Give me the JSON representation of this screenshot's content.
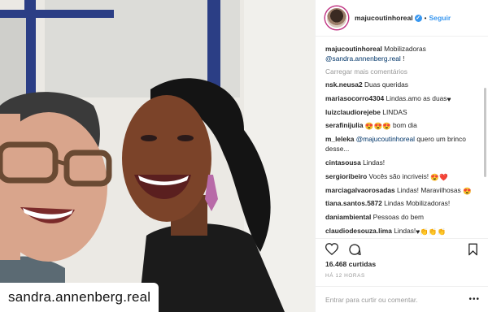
{
  "photo": {
    "watermark": "sandra.annenberg.real"
  },
  "post": {
    "username": "majucoutinhoreal",
    "follow_label": "Seguir",
    "caption_user": "majucoutinhoreal",
    "caption_text": "Mobilizadoras",
    "caption_mention": "@sandra.annenberg.real",
    "caption_tail": "!",
    "load_more": "Carregar mais comentários",
    "comments": [
      {
        "user": "nsk.neusa2",
        "text": "Duas queridas",
        "emoji": ""
      },
      {
        "user": "mariasocorro4304",
        "text": "Lindas.amo as duas",
        "emoji": "♥"
      },
      {
        "user": "luizclaudiorejebe",
        "text": "LINDAS",
        "emoji": ""
      },
      {
        "user": "serafinijulia",
        "text": "bom dia",
        "emoji": "😍😍😍"
      },
      {
        "user": "m_leleka",
        "mention": "@majucoutinhoreal",
        "text": "quero um brinco desse...",
        "emoji": ""
      },
      {
        "user": "cintasousa",
        "text": "Lindas!",
        "emoji": ""
      },
      {
        "user": "sergioribeiro",
        "text": "Vocês são incriveis!",
        "emoji": "😍❤️"
      },
      {
        "user": "marciagalvaorosadas",
        "text": "Lindas! Maravilhosas",
        "emoji": "😍"
      },
      {
        "user": "tiana.santos.5872",
        "text": "Lindas Mobilizadoras!",
        "emoji": ""
      },
      {
        "user": "daniambiental",
        "text": "Pessoas do bem",
        "emoji": ""
      },
      {
        "user": "claudiodesouza.lima",
        "text": "Lindas!",
        "emoji": "♥👏👏👏"
      }
    ],
    "likes": "16.468 curtidas",
    "time": "HÁ 12 HORAS",
    "comment_placeholder": "Entrar para curtir ou comentar.",
    "more_options": "•••"
  },
  "colors": {
    "accent": "#3897f0",
    "link": "#003569",
    "muted": "#999999"
  },
  "icons": [
    "verified-icon",
    "heart-icon",
    "comment-icon",
    "bookmark-icon",
    "more-options-icon"
  ]
}
